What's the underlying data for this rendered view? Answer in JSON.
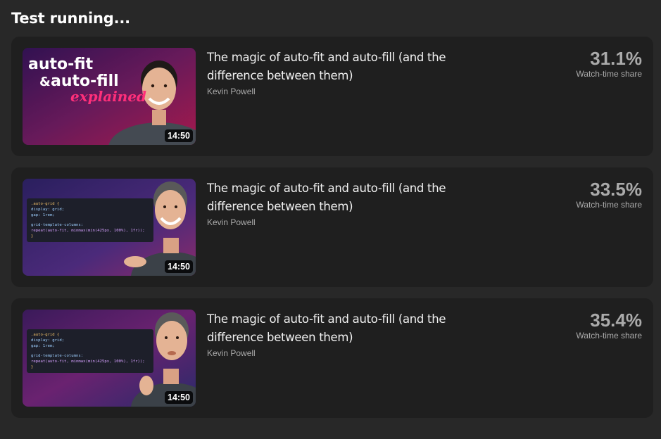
{
  "header": {
    "title": "Test running..."
  },
  "variants": [
    {
      "title": "The magic of auto-fit and auto-fill (and the difference between them)",
      "channel": "Kevin Powell",
      "duration": "14:50",
      "share": "31.1%",
      "share_label": "Watch-time share",
      "thumb_text": [
        "auto-fit",
        "&",
        "auto-fill",
        "explained"
      ]
    },
    {
      "title": "The magic of auto-fit and auto-fill (and the difference between them)",
      "channel": "Kevin Powell",
      "duration": "14:50",
      "share": "33.5%",
      "share_label": "Watch-time share",
      "code": [
        ".auto-grid {",
        "  display: grid;",
        "  gap: 1rem;",
        "",
        "  grid-template-columns:",
        "    repeat(auto-fit, minmax(min(425px, 100%), 1fr));",
        "}"
      ]
    },
    {
      "title": "The magic of auto-fit and auto-fill (and the difference between them)",
      "channel": "Kevin Powell",
      "duration": "14:50",
      "share": "35.4%",
      "share_label": "Watch-time share",
      "code": [
        ".auto-grid {",
        "  display: grid;",
        "  gap: 1rem;",
        "",
        "  grid-template-columns:",
        "    repeat(auto-fit, minmax(min(425px, 100%), 1fr));",
        "}"
      ]
    }
  ]
}
